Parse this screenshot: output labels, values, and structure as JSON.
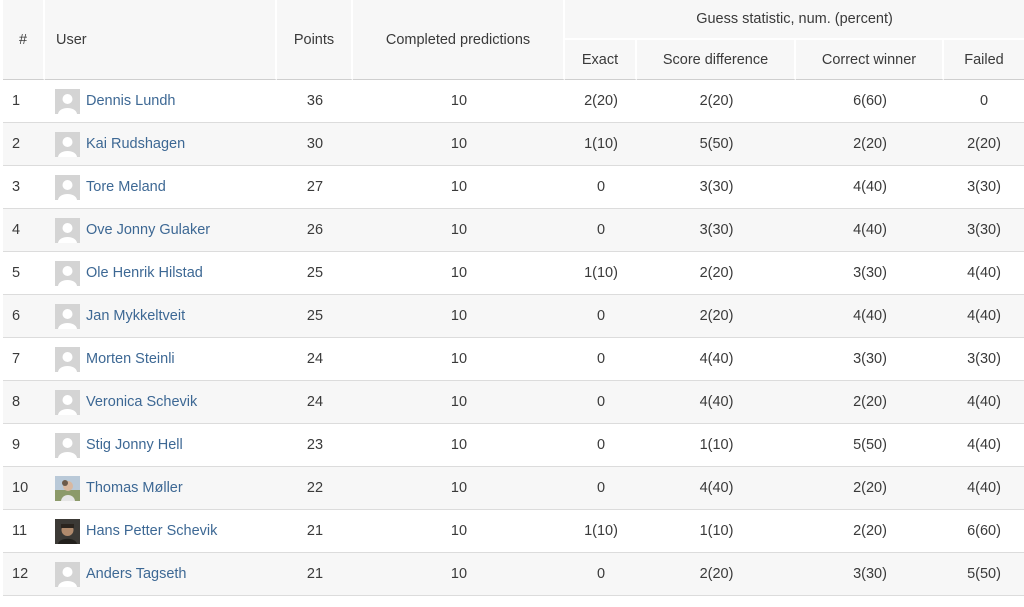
{
  "table": {
    "headers": {
      "index": "#",
      "user": "User",
      "points": "Points",
      "completed": "Completed predictions",
      "guess_group": "Guess statistic, num. (percent)",
      "exact": "Exact",
      "score_difference": "Score difference",
      "correct_winner": "Correct winner",
      "failed": "Failed"
    },
    "rows": [
      {
        "rank": "1",
        "name": "Dennis Lundh",
        "avatar": "default-avatar-icon",
        "points": "36",
        "completed": "10",
        "exact": "2(20)",
        "score_difference": "2(20)",
        "correct_winner": "6(60)",
        "failed": "0"
      },
      {
        "rank": "2",
        "name": "Kai Rudshagen",
        "avatar": "default-avatar-icon",
        "points": "30",
        "completed": "10",
        "exact": "1(10)",
        "score_difference": "5(50)",
        "correct_winner": "2(20)",
        "failed": "2(20)"
      },
      {
        "rank": "3",
        "name": "Tore Meland",
        "avatar": "default-avatar-icon",
        "points": "27",
        "completed": "10",
        "exact": "0",
        "score_difference": "3(30)",
        "correct_winner": "4(40)",
        "failed": "3(30)"
      },
      {
        "rank": "4",
        "name": "Ove Jonny Gulaker",
        "avatar": "default-avatar-icon",
        "points": "26",
        "completed": "10",
        "exact": "0",
        "score_difference": "3(30)",
        "correct_winner": "4(40)",
        "failed": "3(30)"
      },
      {
        "rank": "5",
        "name": "Ole Henrik Hilstad",
        "avatar": "default-avatar-icon",
        "points": "25",
        "completed": "10",
        "exact": "1(10)",
        "score_difference": "2(20)",
        "correct_winner": "3(30)",
        "failed": "4(40)"
      },
      {
        "rank": "6",
        "name": "Jan Mykkeltveit",
        "avatar": "default-avatar-icon",
        "points": "25",
        "completed": "10",
        "exact": "0",
        "score_difference": "2(20)",
        "correct_winner": "4(40)",
        "failed": "4(40)"
      },
      {
        "rank": "7",
        "name": "Morten Steinli",
        "avatar": "default-avatar-icon",
        "points": "24",
        "completed": "10",
        "exact": "0",
        "score_difference": "4(40)",
        "correct_winner": "3(30)",
        "failed": "3(30)"
      },
      {
        "rank": "8",
        "name": "Veronica Schevik",
        "avatar": "default-avatar-icon",
        "points": "24",
        "completed": "10",
        "exact": "0",
        "score_difference": "4(40)",
        "correct_winner": "2(20)",
        "failed": "4(40)"
      },
      {
        "rank": "9",
        "name": "Stig Jonny Hell",
        "avatar": "default-avatar-icon",
        "points": "23",
        "completed": "10",
        "exact": "0",
        "score_difference": "1(10)",
        "correct_winner": "5(50)",
        "failed": "4(40)"
      },
      {
        "rank": "10",
        "name": "Thomas Møller",
        "avatar": "photo-avatar-icon",
        "points": "22",
        "completed": "10",
        "exact": "0",
        "score_difference": "4(40)",
        "correct_winner": "2(20)",
        "failed": "4(40)"
      },
      {
        "rank": "11",
        "name": "Hans Petter Schevik",
        "avatar": "photo-avatar-dark-icon",
        "points": "21",
        "completed": "10",
        "exact": "1(10)",
        "score_difference": "1(10)",
        "correct_winner": "2(20)",
        "failed": "6(60)"
      },
      {
        "rank": "12",
        "name": "Anders Tagseth",
        "avatar": "default-avatar-icon",
        "points": "21",
        "completed": "10",
        "exact": "0",
        "score_difference": "2(20)",
        "correct_winner": "3(30)",
        "failed": "5(50)"
      }
    ]
  },
  "colors": {
    "link": "#3d6894",
    "header_bg": "#f7f7f7",
    "stripe_bg": "#f7f7f7",
    "text": "#3a3a3a"
  }
}
